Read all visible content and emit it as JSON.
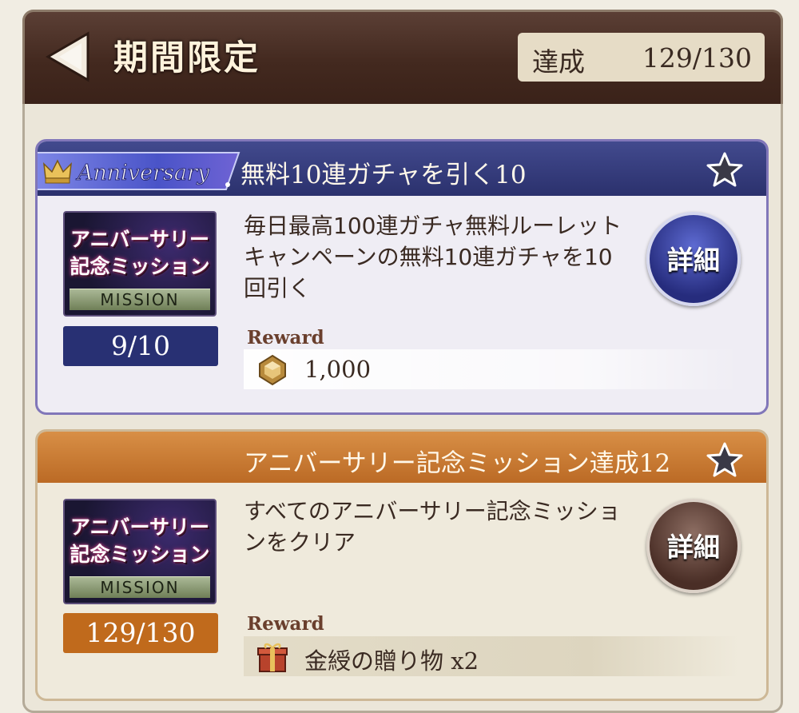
{
  "header": {
    "title": "期間限定",
    "progress_label": "達成",
    "progress_value": "129/130"
  },
  "missions": [
    {
      "badge_text": "Anniversary",
      "title": "無料10連ガチャを引く10",
      "thumbnail": {
        "line1": "アニバーサリー",
        "line2": "記念ミッション",
        "band": "MISSION"
      },
      "counter": "9/10",
      "description": "毎日最高100連ガチャ無料ルーレットキャンペーンの無料10連ガチャを10回引く",
      "detail_button": "詳細",
      "reward_label": "Reward",
      "reward_icon": "crystal-coin-icon",
      "reward_text": "1,000",
      "theme_color": "#2b316d"
    },
    {
      "title": "アニバーサリー記念ミッション達成12",
      "thumbnail": {
        "line1": "アニバーサリー",
        "line2": "記念ミッション",
        "band": "MISSION"
      },
      "counter": "129/130",
      "description": "すべてのアニバーサリー記念ミッションをクリア",
      "detail_button": "詳細",
      "reward_label": "Reward",
      "reward_icon": "gift-box-icon",
      "reward_name": "金綬の贈り物",
      "reward_qty": "x2",
      "theme_color": "#bb6a25"
    }
  ]
}
